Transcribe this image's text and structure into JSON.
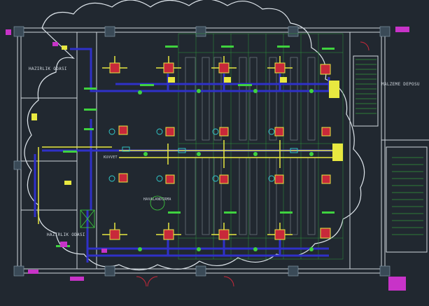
{
  "room_labels": {
    "hazirlik_odasi_top": "HAZIRLIK ODASI",
    "hazirlik_odasi_bottom": "HAZIRLIK ODASI",
    "malzeme_deposu": "MALZEME DEPOSU",
    "havalandirma": "HAVALANDIRMA",
    "kuvvet": "KUVVET"
  },
  "colors": {
    "background": "#212830",
    "wall": "#cfd6dd",
    "column": "#3a4a57",
    "supply_duct": "#2f31c8",
    "exhaust_duct": "#e8e840",
    "diffuser": "#c8283a",
    "grid": "#2f9a3c",
    "cloud": "#dfe6ec",
    "seating": "#6a737c",
    "magenta": "#c833c8",
    "cyan": "#32d2d2",
    "green_tag": "#3fd23f"
  }
}
